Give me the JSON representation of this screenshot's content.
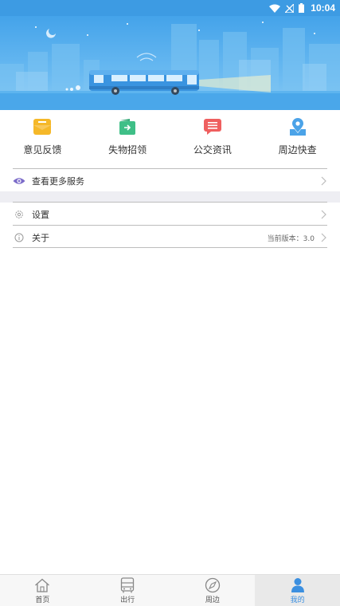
{
  "status_bar": {
    "time": "10:04"
  },
  "quick_menu": [
    {
      "label": "意见反馈",
      "icon": "feedback-icon",
      "color": "#f5b829"
    },
    {
      "label": "失物招领",
      "icon": "lost-found-icon",
      "color": "#3fbf87"
    },
    {
      "label": "公交资讯",
      "icon": "news-icon",
      "color": "#ef5f5f"
    },
    {
      "label": "周边快查",
      "icon": "location-icon",
      "color": "#4ba3e8"
    }
  ],
  "more_services": {
    "label": "查看更多服务",
    "icon": "eye-icon"
  },
  "settings": {
    "label": "设置",
    "icon": "gear-icon"
  },
  "about": {
    "label": "关于",
    "icon": "info-icon",
    "version_text": "当前版本：3.0"
  },
  "tab_bar": {
    "tabs": [
      {
        "label": "首页",
        "icon": "home-icon"
      },
      {
        "label": "出行",
        "icon": "bus-icon"
      },
      {
        "label": "周边",
        "icon": "compass-icon"
      },
      {
        "label": "我的",
        "icon": "user-icon"
      }
    ],
    "active_index": 3
  },
  "colors": {
    "accent": "#3b8fe0",
    "status_bar": "#3d9be3"
  }
}
